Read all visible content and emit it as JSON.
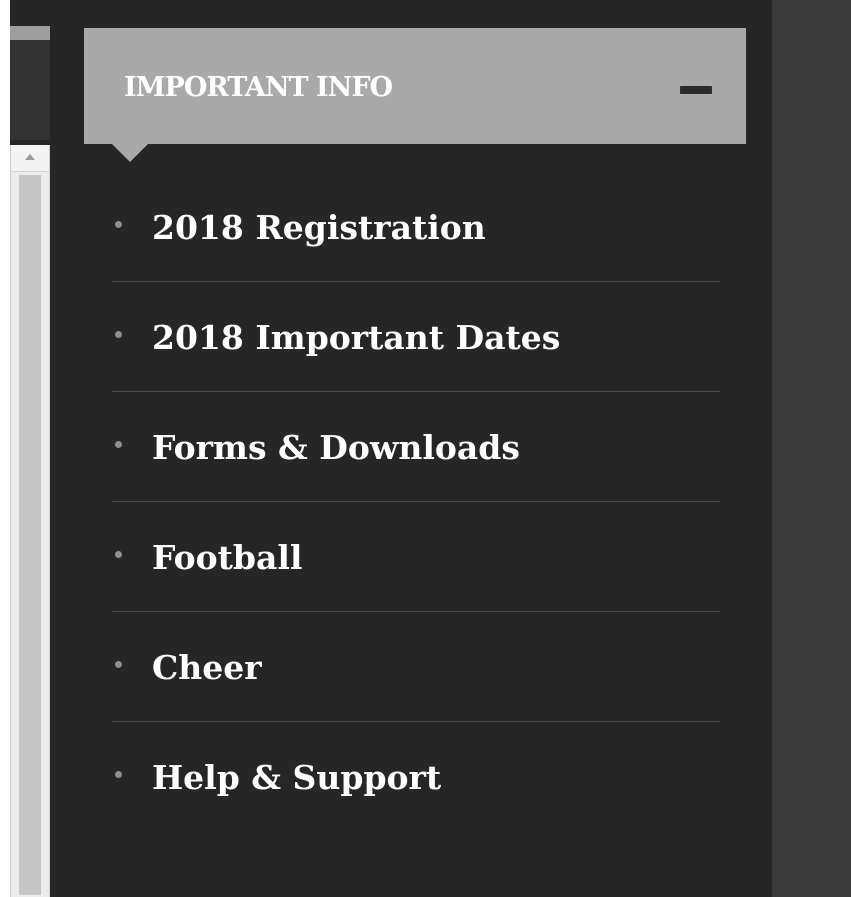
{
  "panel": {
    "title": "IMPORTANT INFO",
    "collapse_icon": "minus-icon"
  },
  "menu": {
    "items": [
      {
        "label": "2018 Registration"
      },
      {
        "label": "2018 Important Dates"
      },
      {
        "label": "Forms & Downloads"
      },
      {
        "label": "Football"
      },
      {
        "label": "Cheer"
      },
      {
        "label": "Help & Support"
      }
    ]
  },
  "colors": {
    "panel_background": "#262626",
    "header_background": "#a9a9a9",
    "text": "#ffffff",
    "bullet": "#8f8f8f",
    "divider": "#4a4a4a"
  }
}
